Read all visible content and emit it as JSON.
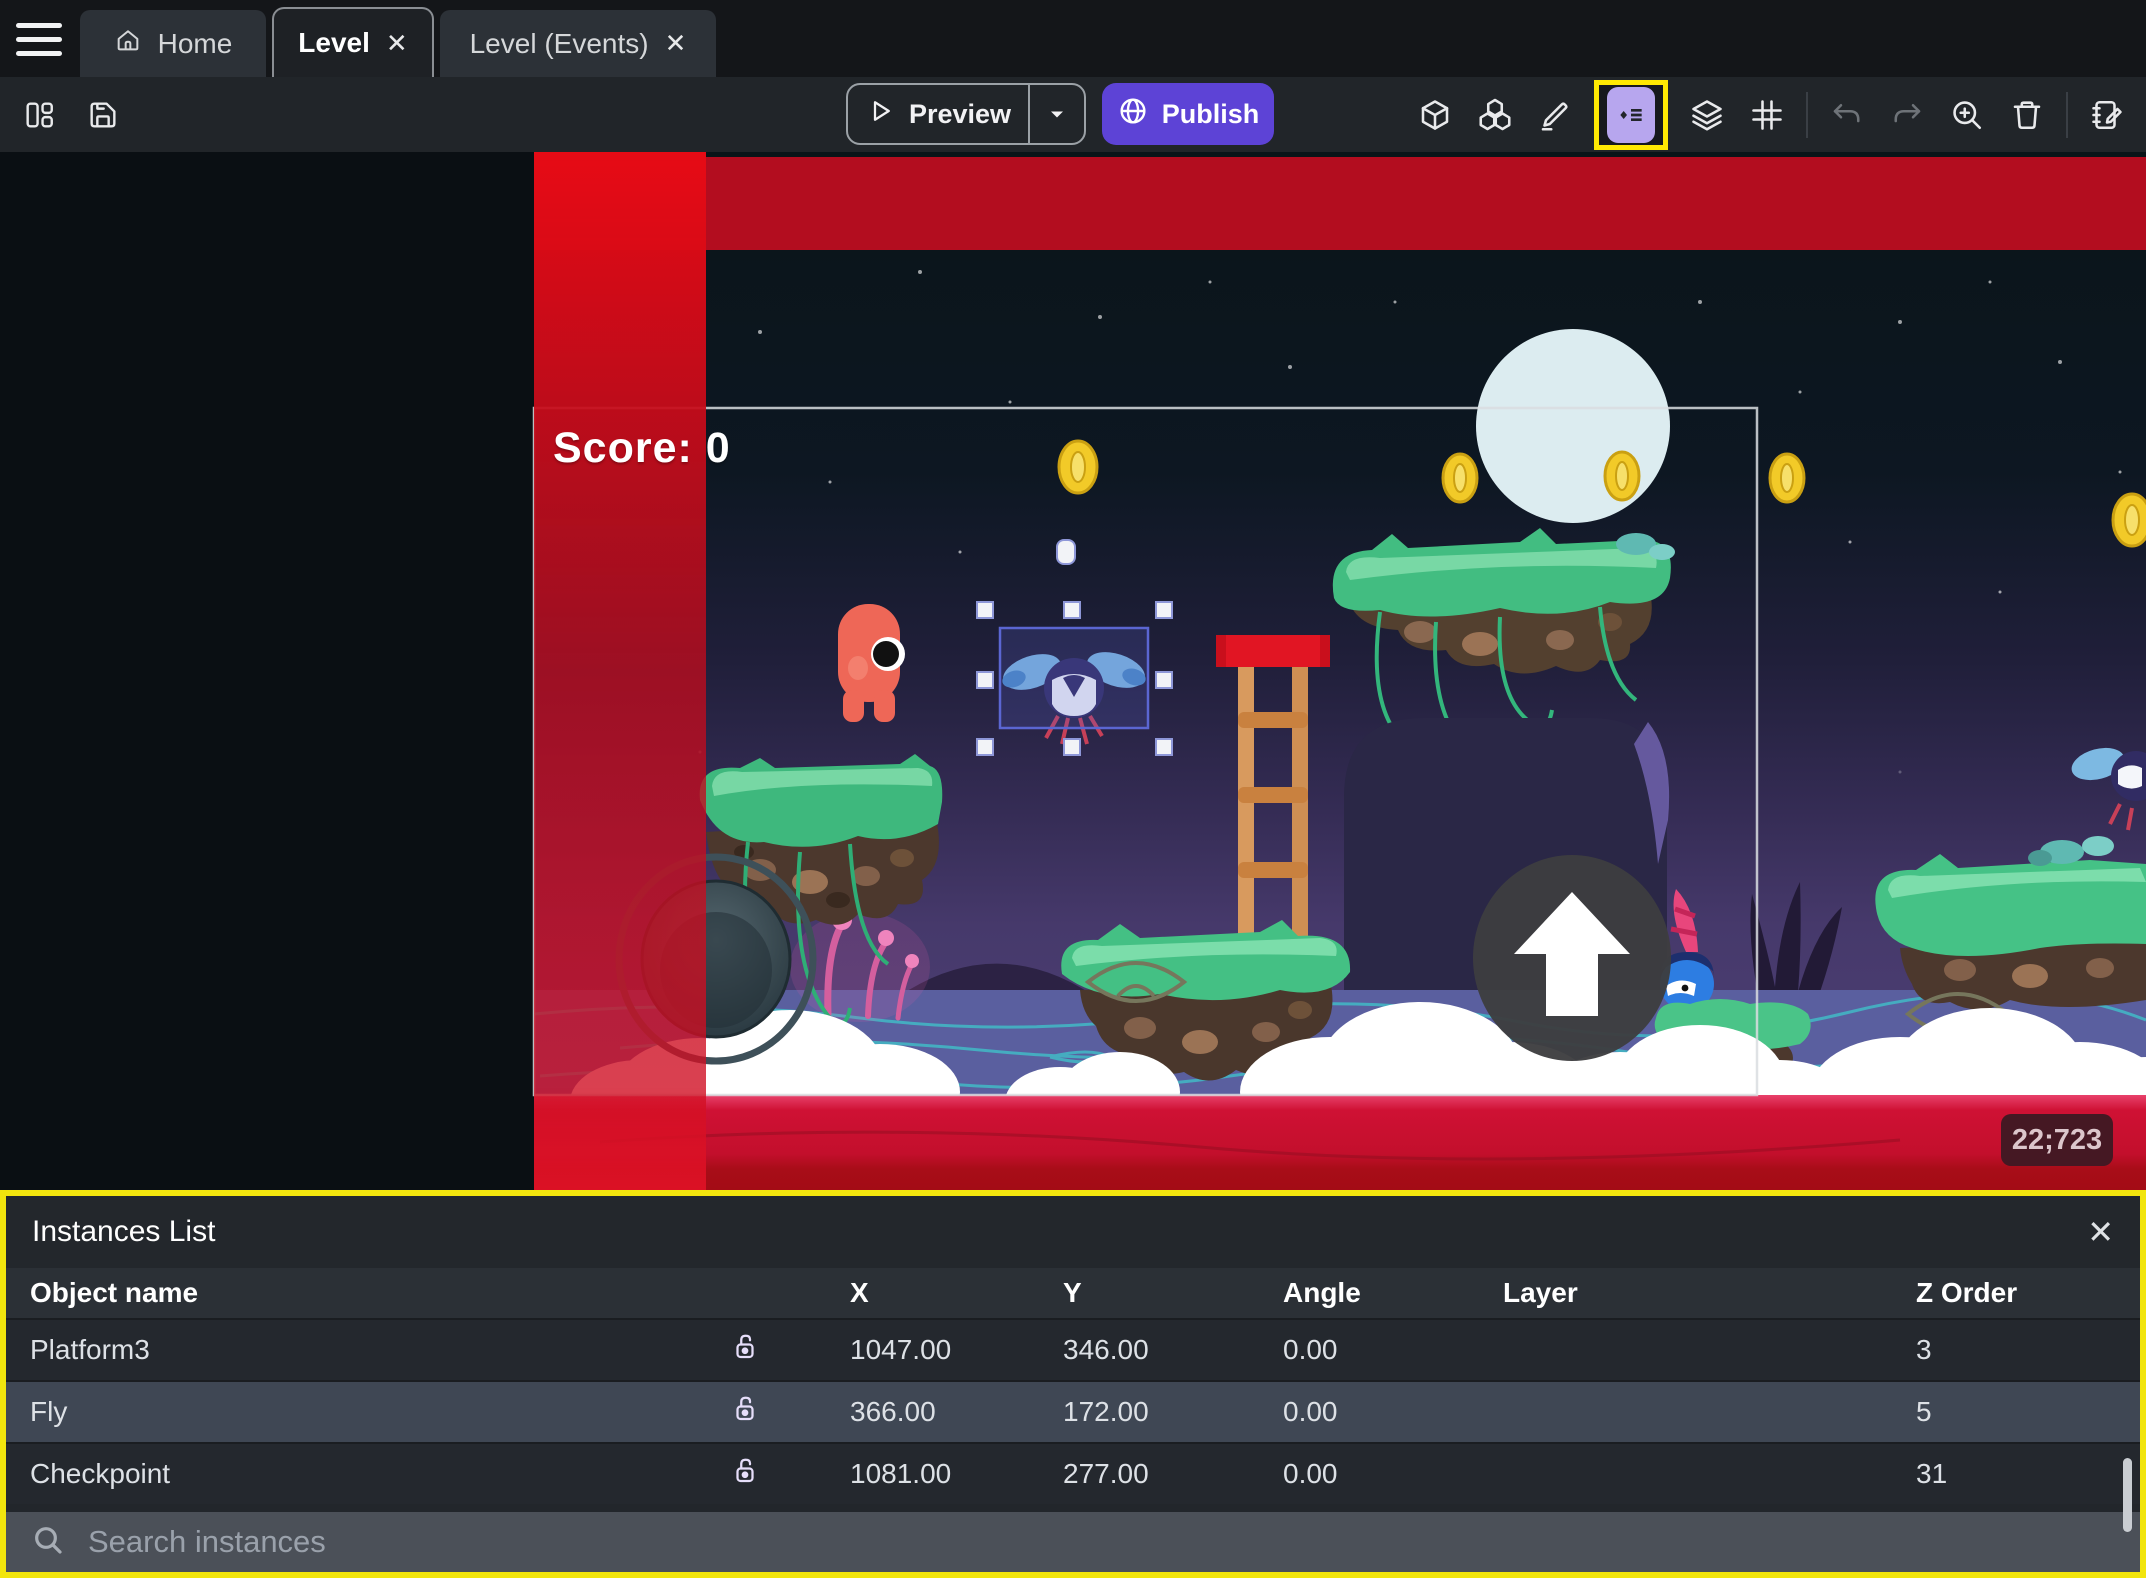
{
  "tabbar": {
    "tabs": [
      {
        "label": "Home"
      },
      {
        "label": "Level"
      },
      {
        "label": "Level (Events)"
      }
    ]
  },
  "toolbar": {
    "preview_label": "Preview",
    "publish_label": "Publish"
  },
  "scene": {
    "score_text": "Score: 0",
    "coords_label": "22;723"
  },
  "panel": {
    "title": "Instances List",
    "columns": [
      "Object name",
      "X",
      "Y",
      "Angle",
      "Layer",
      "Z Order"
    ],
    "rows": [
      {
        "name": "Platform3",
        "x": "1047.00",
        "y": "346.00",
        "angle": "0.00",
        "layer": "",
        "z_order": "3"
      },
      {
        "name": "Fly",
        "x": "366.00",
        "y": "172.00",
        "angle": "0.00",
        "layer": "",
        "z_order": "5"
      },
      {
        "name": "Checkpoint",
        "x": "1081.00",
        "y": "277.00",
        "angle": "0.00",
        "layer": "",
        "z_order": "31"
      }
    ],
    "search_placeholder": "Search instances"
  },
  "icons": {
    "close": "✕"
  },
  "colors": {
    "accent_purple": "#5d43d6",
    "highlight_yellow": "#f2e50d",
    "selection_blue": "#5b66d2",
    "selected_row": "#3f4754",
    "boundary_red": "#c11024"
  }
}
